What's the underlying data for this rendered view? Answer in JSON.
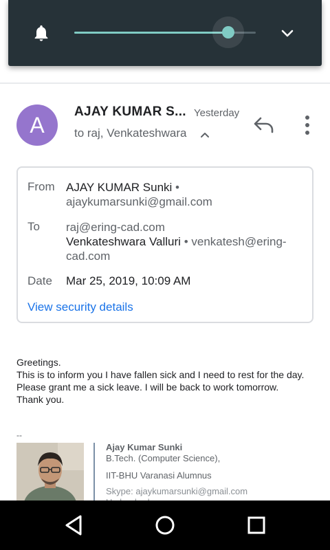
{
  "volume": {
    "level": 0.85,
    "accent_color": "#80cbc4",
    "ring_icon": "bell-icon",
    "expand_icon": "chevron-down-icon"
  },
  "email": {
    "avatar_letter": "A",
    "avatar_color": "#9575cd",
    "sender_display": "AJAY KUMAR S...",
    "date_short": "Yesterday",
    "recipients_summary": "to raj, Venkateshwara",
    "details": {
      "from_label": "From",
      "from_name": "AJAY KUMAR Sunki",
      "from_email": "ajaykumarsunki@gmail.com",
      "to_label": "To",
      "to_first": "raj@ering-cad.com",
      "to_second_name": "Venkateshwara Valluri",
      "to_second_email": "venkatesh@ering-cad.com",
      "date_label": "Date",
      "date_value": "Mar 25, 2019, 10:09 AM",
      "security_link": "View security details",
      "link_color": "#1a73e8"
    },
    "body": {
      "greeting": "Greetings.",
      "message": "This is to inform you I have fallen sick and I need to rest for the day. Please grant me a sick leave. I will be back to work tomorrow.",
      "closing": "Thank you."
    },
    "signature": {
      "dash": "--",
      "name": "Ajay Kumar Sunki",
      "degree": "B.Tech. (Computer Science),",
      "alumni": "IIT-BHU Varanasi Alumnus",
      "skype": "Skype: ajaykumarsunki@gmail.com",
      "city": "Hyderabad"
    }
  },
  "navbar": {
    "back_icon": "back-triangle-icon",
    "home_icon": "home-circle-icon",
    "recents_icon": "recents-square-icon"
  }
}
